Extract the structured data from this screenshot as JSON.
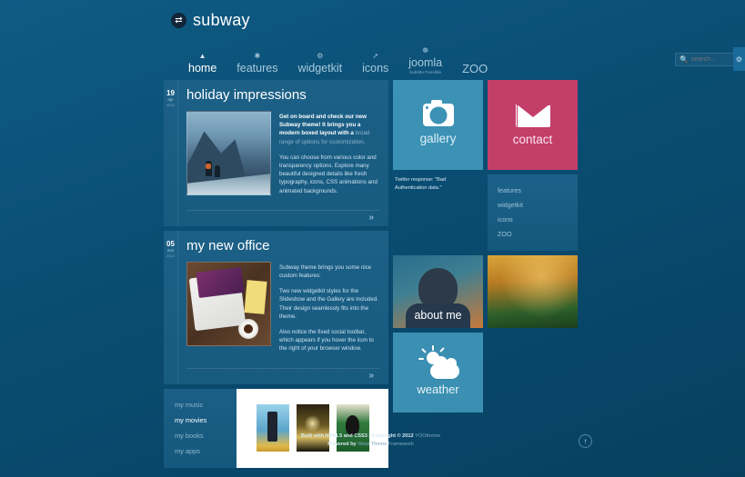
{
  "site": {
    "logo_text": "subway",
    "logo_icon": "swap-arrows-icon"
  },
  "nav": {
    "items": [
      {
        "label": "home",
        "icon": "home-icon",
        "sub": "",
        "active": true
      },
      {
        "label": "features",
        "icon": "star-icon",
        "sub": "",
        "active": false
      },
      {
        "label": "widgetkit",
        "icon": "gear-icon",
        "sub": "",
        "active": false
      },
      {
        "label": "icons",
        "icon": "wand-icon",
        "sub": "",
        "active": false
      },
      {
        "label": "joomla",
        "icon": "joomla-icon",
        "sub": "Subtitle Possible",
        "active": false
      },
      {
        "label": "ZOO",
        "icon": "",
        "sub": "",
        "active": false
      }
    ]
  },
  "search": {
    "placeholder": "search...",
    "value": "",
    "icon": "search-icon"
  },
  "edge_tab": {
    "icon": "social-toolbar-icon"
  },
  "articles": [
    {
      "date": {
        "day": "19",
        "month": "apr",
        "year": "2012"
      },
      "title": "holiday impressions",
      "image_alt": "mountain-hikers-photo",
      "paragraphs": [
        {
          "lead_bold": "Get on board and check our new Subway theme! It brings you a modern boxed layout with a",
          "lead_muted": " broad range of options for customization."
        },
        {
          "text": "You can choose from various color and transparency options. Explore many beautiful designed details like fresh typography, icons, CSS animations and animated backgrounds."
        }
      ],
      "more_label": "»"
    },
    {
      "date": {
        "day": "05",
        "month": "mar",
        "year": "2012"
      },
      "title": "my new office",
      "image_alt": "laptop-desk-coffee-photo",
      "paragraphs": [
        {
          "text": "Subway theme brings you some nice custom features:"
        },
        {
          "text": "Two new widgetkit styles for the Slideshow and the Gallery are included. Their design seamlessly fits into the theme."
        },
        {
          "text": "Also notice the fixed social toolbar, which appears if you hover the icon to the right of your browser window."
        }
      ],
      "more_label": "»"
    }
  ],
  "media_module": {
    "menu": [
      {
        "label": "my music",
        "active": false
      },
      {
        "label": "my movies",
        "active": true
      },
      {
        "label": "my books",
        "active": false
      },
      {
        "label": "my apps",
        "active": false
      }
    ],
    "posters": [
      {
        "alt": "movie-poster-1"
      },
      {
        "alt": "movie-poster-2"
      },
      {
        "alt": "movie-poster-3"
      }
    ]
  },
  "tiles": {
    "gallery": {
      "label": "gallery",
      "icon": "camera-icon",
      "color": "#3b92b5"
    },
    "contact": {
      "label": "contact",
      "icon": "envelope-icon",
      "color": "#c43e6a"
    },
    "about": {
      "label": "about me",
      "image_alt": "portrait-photo"
    },
    "autumn": {
      "label": "",
      "image_alt": "autumn-forest-photo"
    },
    "weather": {
      "label": "weather",
      "icon": "sun-cloud-icon",
      "color": "#3b8fb2"
    }
  },
  "twitter": {
    "message": "Twitter response: \"Bad Authentication data.\""
  },
  "side_menu": {
    "items": [
      {
        "label": "features"
      },
      {
        "label": "widgetkit"
      },
      {
        "label": "icons"
      },
      {
        "label": "ZOO"
      }
    ]
  },
  "footer": {
    "line1_bold": "Built with HTML5 and CSS3 | Copyright © 2012 ",
    "line1_rest": "YOOtheme",
    "line2_bold": "Powered by ",
    "line2_rest": "Warp Theme Framework",
    "totop_icon": "arrow-up-icon"
  }
}
